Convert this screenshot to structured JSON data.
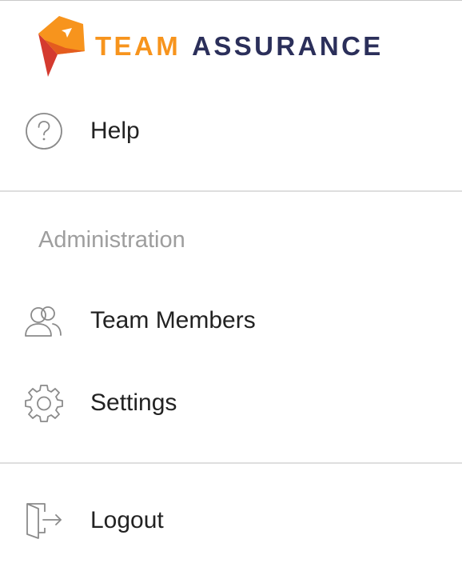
{
  "brand": {
    "word1": "TEAM",
    "word2": "ASSURANCE",
    "colors": {
      "orange": "#f7941d",
      "navy": "#2b2f5a",
      "red": "#d43a2f"
    }
  },
  "menu": {
    "help": {
      "label": "Help",
      "icon": "help-circle-icon"
    },
    "administration": {
      "header": "Administration",
      "items": [
        {
          "label": "Team Members",
          "icon": "users-icon"
        },
        {
          "label": "Settings",
          "icon": "gear-icon"
        }
      ]
    },
    "logout": {
      "label": "Logout",
      "icon": "logout-icon"
    }
  }
}
